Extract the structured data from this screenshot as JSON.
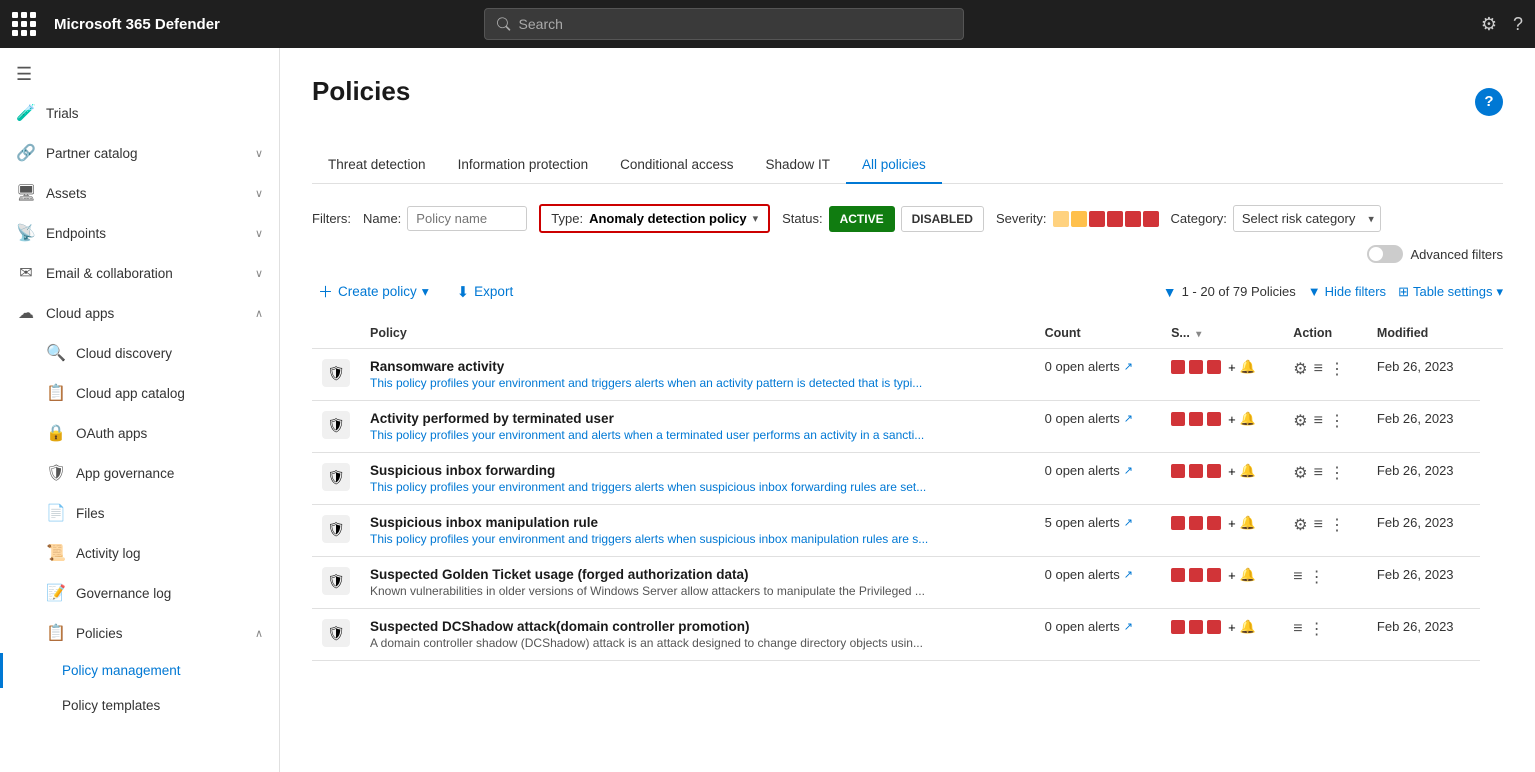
{
  "topnav": {
    "app_name": "Microsoft 365 Defender",
    "search_placeholder": "Search",
    "settings_icon": "⚙",
    "help_icon": "?"
  },
  "sidebar": {
    "hamburger": "☰",
    "items": [
      {
        "id": "trials",
        "label": "Trials",
        "icon": "🧪",
        "expandable": false
      },
      {
        "id": "partner-catalog",
        "label": "Partner catalog",
        "icon": "🔗",
        "expandable": true
      },
      {
        "id": "assets",
        "label": "Assets",
        "icon": "🖥",
        "expandable": true
      },
      {
        "id": "endpoints",
        "label": "Endpoints",
        "icon": "📡",
        "expandable": true
      },
      {
        "id": "email-collaboration",
        "label": "Email & collaboration",
        "icon": "✉",
        "expandable": true
      },
      {
        "id": "cloud-apps",
        "label": "Cloud apps",
        "icon": "☁",
        "expandable": true,
        "expanded": true
      },
      {
        "id": "cloud-discovery",
        "label": "Cloud discovery",
        "icon": "🔍",
        "indent": true
      },
      {
        "id": "cloud-app-catalog",
        "label": "Cloud app catalog",
        "icon": "📋",
        "indent": true
      },
      {
        "id": "oauth-apps",
        "label": "OAuth apps",
        "icon": "🔒",
        "indent": true
      },
      {
        "id": "app-governance",
        "label": "App governance",
        "icon": "🛡",
        "indent": true
      },
      {
        "id": "files",
        "label": "Files",
        "icon": "📄",
        "indent": true
      },
      {
        "id": "activity-log",
        "label": "Activity log",
        "icon": "📜",
        "indent": true
      },
      {
        "id": "governance-log",
        "label": "Governance log",
        "icon": "📝",
        "indent": true
      },
      {
        "id": "policies",
        "label": "Policies",
        "icon": "📋",
        "indent": true,
        "expandable": true,
        "expanded": true,
        "active": false
      },
      {
        "id": "policy-management",
        "label": "Policy management",
        "indent": true,
        "active": true
      },
      {
        "id": "policy-templates",
        "label": "Policy templates",
        "indent": true
      }
    ]
  },
  "main": {
    "page_title": "Policies",
    "help_label": "?",
    "tabs": [
      {
        "id": "threat-detection",
        "label": "Threat detection",
        "active": false
      },
      {
        "id": "information-protection",
        "label": "Information protection",
        "active": false
      },
      {
        "id": "conditional-access",
        "label": "Conditional access",
        "active": false
      },
      {
        "id": "shadow-it",
        "label": "Shadow IT",
        "active": false
      },
      {
        "id": "all-policies",
        "label": "All policies",
        "active": true
      }
    ],
    "filters": {
      "label": "Filters:",
      "name_label": "Name:",
      "name_placeholder": "Policy name",
      "type_label": "Type:",
      "type_value": "Anomaly detection policy",
      "status_label": "Status:",
      "status_active": "ACTIVE",
      "status_disabled": "DISABLED",
      "severity_label": "Severity:",
      "category_label": "Category:",
      "category_value": "Select risk category",
      "advanced_filters_label": "Advanced filters"
    },
    "toolbar": {
      "create_policy": "Create policy",
      "export": "Export",
      "policies_count": "1 - 20 of 79 Policies",
      "hide_filters": "Hide filters",
      "table_settings": "Table settings"
    },
    "table": {
      "columns": [
        "",
        "Policy",
        "Count",
        "S...",
        "Action",
        "Modified"
      ],
      "rows": [
        {
          "id": 1,
          "name": "Ransomware activity",
          "desc": "This policy profiles your environment and triggers alerts when an activity pattern is detected that is typi...",
          "count": "0 open alerts",
          "severity": "high",
          "modified": "Feb 26, 2023"
        },
        {
          "id": 2,
          "name": "Activity performed by terminated user",
          "desc": "This policy profiles your environment and alerts when a terminated user performs an activity in a sancti...",
          "count": "0 open alerts",
          "severity": "high",
          "modified": "Feb 26, 2023"
        },
        {
          "id": 3,
          "name": "Suspicious inbox forwarding",
          "desc": "This policy profiles your environment and triggers alerts when suspicious inbox forwarding rules are set...",
          "count": "0 open alerts",
          "severity": "high",
          "modified": "Feb 26, 2023"
        },
        {
          "id": 4,
          "name": "Suspicious inbox manipulation rule",
          "desc": "This policy profiles your environment and triggers alerts when suspicious inbox manipulation rules are s...",
          "count": "5 open alerts",
          "severity": "high",
          "modified": "Feb 26, 2023"
        },
        {
          "id": 5,
          "name": "Suspected Golden Ticket usage (forged authorization data)",
          "desc": "Known vulnerabilities in older versions of Windows Server allow attackers to manipulate the Privileged ...",
          "desc_black": true,
          "count": "0 open alerts",
          "severity": "high",
          "modified": "Feb 26, 2023",
          "no_gear": true
        },
        {
          "id": 6,
          "name": "Suspected DCShadow attack(domain controller promotion)",
          "desc": "A domain controller shadow (DCShadow) attack is an attack designed to change directory objects usin...",
          "desc_black": true,
          "count": "0 open alerts",
          "severity": "high",
          "modified": "Feb 26, 2023",
          "no_gear": true
        }
      ]
    }
  }
}
